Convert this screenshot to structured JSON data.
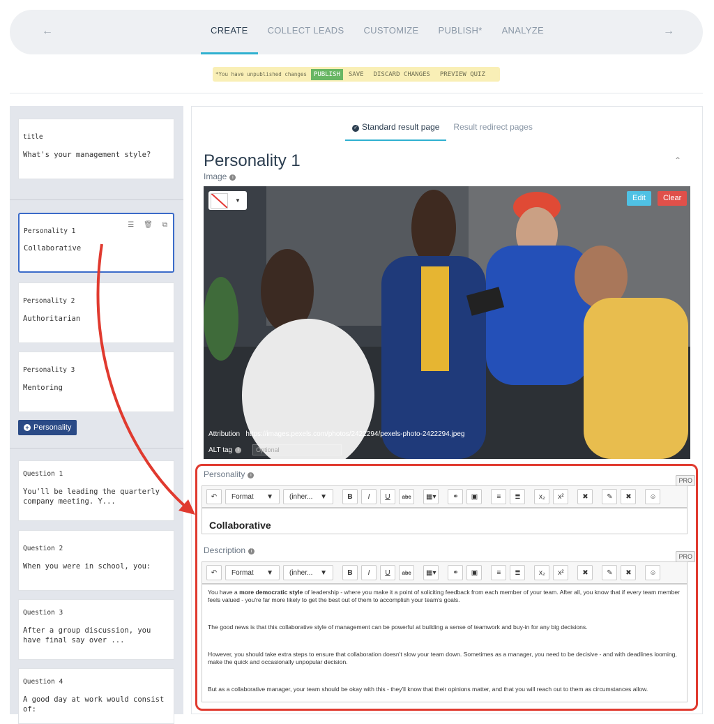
{
  "nav": {
    "back_icon": "arrow-left-icon",
    "forward_icon": "arrow-right-icon",
    "tabs": [
      {
        "label": "CREATE",
        "active": true
      },
      {
        "label": "COLLECT LEADS",
        "active": false
      },
      {
        "label": "CUSTOMIZE",
        "active": false
      },
      {
        "label": "PUBLISH*",
        "active": false
      },
      {
        "label": "ANALYZE",
        "active": false
      }
    ]
  },
  "banner": {
    "note": "*You have unpublished changes",
    "publish": "PUBLISH",
    "save": "SAVE",
    "discard": "DISCARD CHANGES",
    "preview": "PREVIEW QUIZ"
  },
  "sidebar": {
    "title_card": {
      "label": "title",
      "value": "What's your management style?"
    },
    "personalities": [
      {
        "label": "Personality 1",
        "value": "Collaborative",
        "selected": true
      },
      {
        "label": "Personality 2",
        "value": "Authoritarian",
        "selected": false
      },
      {
        "label": "Personality 3",
        "value": "Mentoring",
        "selected": false
      }
    ],
    "add_personality": "Personality",
    "questions": [
      {
        "label": "Question 1",
        "value": "You'll be leading the quarterly company meeting. Y..."
      },
      {
        "label": "Question 2",
        "value": "When you were in school, you:"
      },
      {
        "label": "Question 3",
        "value": "After a group discussion, you have final say over ..."
      },
      {
        "label": "Question 4",
        "value": "A good day at work would consist of:"
      }
    ]
  },
  "main": {
    "result_tabs": [
      {
        "label": "Standard result page",
        "active": true
      },
      {
        "label": "Result redirect pages",
        "active": false
      }
    ],
    "title": "Personality 1",
    "image_label": "Image",
    "edit": "Edit",
    "clear": "Clear",
    "attribution_label": "Attribution",
    "attribution_url": "https://images.pexels.com/photos/2422294/pexels-photo-2422294.jpeg",
    "alt_label": "ALT tag",
    "alt_placeholder": "Optional",
    "personality_label": "Personality",
    "description_label": "Description",
    "pro": "PRO",
    "toolbar": {
      "format": "Format",
      "font": "(inher...",
      "bold": "B",
      "italic": "I",
      "underline": "U",
      "strike": "abc"
    },
    "personality_value": "Collaborative",
    "description": {
      "p1_pre": "You have a ",
      "p1_bold": "more democratic style",
      "p1_post": " of leadership - where you make it a point of soliciting feedback from each member of your team. After all, you know that if every team member feels valued - you're far more likely to get the best out of them to accomplish your team's goals.",
      "p2": "The good news is that this collaborative style of management can be powerful at building a sense of teamwork and buy-in for any big decisions.",
      "p3": "However, you should take extra steps to ensure that collaboration doesn't slow your team down. Sometimes as a manager, you need to be decisive - and with deadlines looming, make the quick and occasionally unpopular decision.",
      "p4": "But as a collaborative manager, your team should be okay with this - they'll know that their opinions matter, and that you will reach out to them as circumstances allow."
    }
  },
  "colors": {
    "accent": "#2fb0d0",
    "brand": "#2a4a86",
    "highlight": "#e03a2f",
    "publish": "#68b663"
  }
}
